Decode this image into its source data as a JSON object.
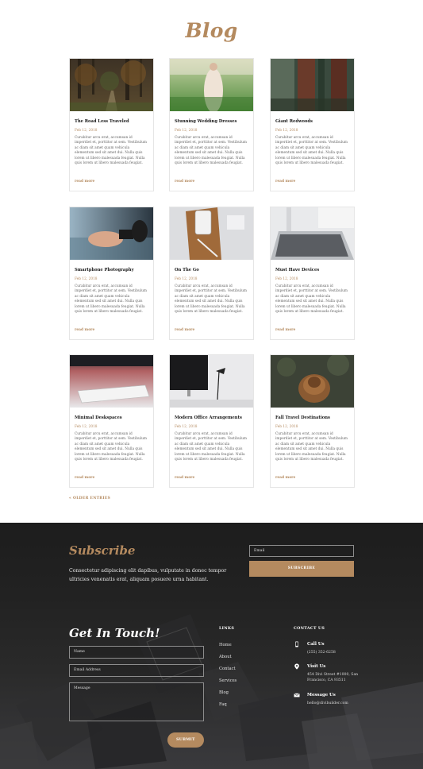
{
  "page": {
    "title": "Blog"
  },
  "posts": [
    {
      "title": "The Road Less Traveled",
      "date": "Feb 12, 2018",
      "excerpt": "Curabitur arcu erat, accumsan id imperdiet et, porttitor at sem. Vestibulum ac diam sit amet quam vehicula elementum sed sit amet dui. Nulla quis lorem ut libero malesuada feugiat. Nulla quis lorem ut libero malesuada feugiat.",
      "read_more": "read more"
    },
    {
      "title": "Stunning Wedding Dresses",
      "date": "Feb 12, 2018",
      "excerpt": "Curabitur arcu erat, accumsan id imperdiet et, porttitor at sem. Vestibulum ac diam sit amet quam vehicula elementum sed sit amet dui. Nulla quis lorem ut libero malesuada feugiat. Nulla quis lorem ut libero malesuada feugiat.",
      "read_more": "read more"
    },
    {
      "title": "Giant Redwoods",
      "date": "Feb 12, 2018",
      "excerpt": "Curabitur arcu erat, accumsan id imperdiet et, porttitor at sem. Vestibulum ac diam sit amet quam vehicula elementum sed sit amet dui. Nulla quis lorem ut libero malesuada feugiat. Nulla quis lorem ut libero malesuada feugiat.",
      "read_more": "read more"
    },
    {
      "title": "Smartphone Photography",
      "date": "Feb 12, 2018",
      "excerpt": "Curabitur arcu erat, accumsan id imperdiet et, porttitor at sem. Vestibulum ac diam sit amet quam vehicula elementum sed sit amet dui. Nulla quis lorem ut libero malesuada feugiat. Nulla quis lorem ut libero malesuada feugiat.",
      "read_more": "read more"
    },
    {
      "title": "On The Go",
      "date": "Feb 12, 2018",
      "excerpt": "Curabitur arcu erat, accumsan id imperdiet et, porttitor at sem. Vestibulum ac diam sit amet quam vehicula elementum sed sit amet dui. Nulla quis lorem ut libero malesuada feugiat. Nulla quis lorem ut libero malesuada feugiat.",
      "read_more": "read more"
    },
    {
      "title": "Must Have Devices",
      "date": "Feb 12, 2018",
      "excerpt": "Curabitur arcu erat, accumsan id imperdiet et, porttitor at sem. Vestibulum ac diam sit amet quam vehicula elementum sed sit amet dui. Nulla quis lorem ut libero malesuada feugiat. Nulla quis lorem ut libero malesuada feugiat.",
      "read_more": "read more"
    },
    {
      "title": "Minimal Deskspaces",
      "date": "Feb 12, 2018",
      "excerpt": "Curabitur arcu erat, accumsan id imperdiet et, porttitor at sem. Vestibulum ac diam sit amet quam vehicula elementum sed sit amet dui. Nulla quis lorem ut libero malesuada feugiat. Nulla quis lorem ut libero malesuada feugiat.",
      "read_more": "read more"
    },
    {
      "title": "Modern Office Arrangements",
      "date": "Feb 12, 2018",
      "excerpt": "Curabitur arcu erat, accumsan id imperdiet et, porttitor at sem. Vestibulum ac diam sit amet quam vehicula elementum sed sit amet dui. Nulla quis lorem ut libero malesuada feugiat. Nulla quis lorem ut libero malesuada feugiat.",
      "read_more": "read more"
    },
    {
      "title": "Fall Travel Destinations",
      "date": "Feb 12, 2018",
      "excerpt": "Curabitur arcu erat, accumsan id imperdiet et, porttitor at sem. Vestibulum ac diam sit amet quam vehicula elementum sed sit amet dui. Nulla quis lorem ut libero malesuada feugiat. Nulla quis lorem ut libero malesuada feugiat.",
      "read_more": "read more"
    }
  ],
  "pagination": {
    "older": "« OLDER ENTRIES"
  },
  "subscribe": {
    "title": "Subscribe",
    "text": "Consectetur adipiscing elit dapibus, vulputate in donec tempor ultricies venenatis erat, aliquam posuere urna habitant.",
    "email_placeholder": "Email",
    "button": "SUBSCRIBE"
  },
  "contact_form": {
    "title": "Get In Touch!",
    "name_placeholder": "Name",
    "email_placeholder": "Email Address",
    "message_placeholder": "Message",
    "button": "SUBMIT"
  },
  "links": {
    "heading": "LINKS",
    "items": [
      "Home",
      "About",
      "Contact",
      "Services",
      "Blog",
      "Faq"
    ]
  },
  "contact_us": {
    "heading": "CONTACT US",
    "items": [
      {
        "icon": "phone-icon",
        "title": "Call Us",
        "value": "(255) 352-6258"
      },
      {
        "icon": "map-pin-icon",
        "title": "Visit Us",
        "value": "454 Divi Street #1000, San Francisco, CA 93511"
      },
      {
        "icon": "envelope-icon",
        "title": "Message Us",
        "value": "hello@divibuilder.com"
      }
    ]
  },
  "colors": {
    "accent": "#b48a5f",
    "footer_bg": "#1d1d1d"
  }
}
